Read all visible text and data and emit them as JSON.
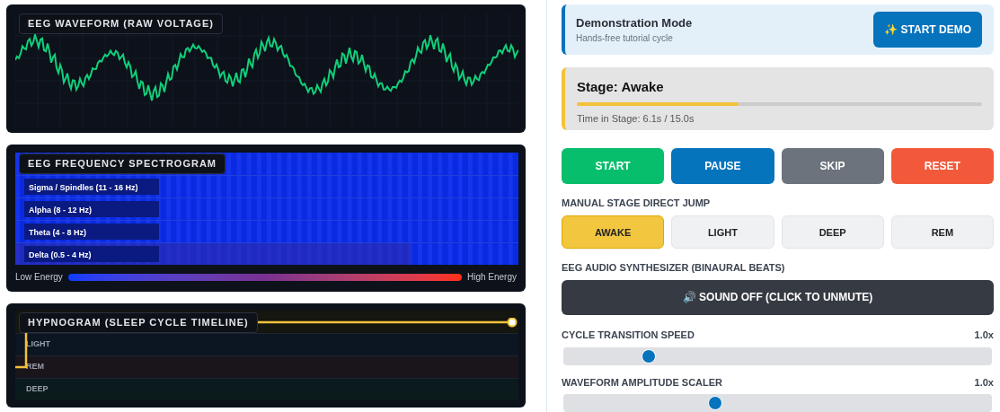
{
  "waveform": {
    "title": "EEG WAVEFORM (RAW VOLTAGE)"
  },
  "spectrogram": {
    "title": "EEG FREQUENCY SPECTROGRAM",
    "bands": [
      {
        "label": "Sigma / Spindles (11 - 16 Hz)"
      },
      {
        "label": "Alpha (8 - 12 Hz)"
      },
      {
        "label": "Theta (4 - 8 Hz)"
      },
      {
        "label": "Delta (0.5 - 4 Hz)"
      }
    ],
    "legend": {
      "low": "Low Energy",
      "high": "High Energy"
    }
  },
  "hypnogram": {
    "title": "HYPNOGRAM (SLEEP CYCLE TIMELINE)",
    "rows": [
      {
        "label": "LIGHT",
        "kind": "light"
      },
      {
        "label": "REM",
        "kind": "rem"
      },
      {
        "label": "DEEP",
        "kind": "deep"
      }
    ]
  },
  "demo": {
    "title": "Demonstration Mode",
    "subtitle": "Hands-free tutorial cycle",
    "button": "✨ START DEMO"
  },
  "stage": {
    "title": "Stage: Awake",
    "level": 0.4,
    "time": "Time in Stage: 6.1s / 15.0s"
  },
  "controls": [
    {
      "label": "START",
      "kind": "start"
    },
    {
      "label": "PAUSE",
      "kind": "pause"
    },
    {
      "label": "SKIP",
      "kind": "skip"
    },
    {
      "label": "RESET",
      "kind": "reset"
    }
  ],
  "jump": {
    "label": "MANUAL STAGE DIRECT JUMP",
    "stages": [
      {
        "label": "AWAKE",
        "selected": true
      },
      {
        "label": "LIGHT",
        "selected": false
      },
      {
        "label": "DEEP",
        "selected": false
      },
      {
        "label": "REM",
        "selected": false
      }
    ]
  },
  "audio": {
    "label": "EEG AUDIO SYNTHESIZER (BINAURAL BEATS)",
    "button": "🔊 SOUND OFF (CLICK TO UNMUTE)",
    "on": false
  },
  "sliders": [
    {
      "label": "CYCLE TRANSITION SPEED",
      "reading": "1.0x",
      "level": 0.2
    },
    {
      "label": "WAVEFORM AMPLITUDE SCALER",
      "reading": "1.0x",
      "level": 0.355
    }
  ]
}
